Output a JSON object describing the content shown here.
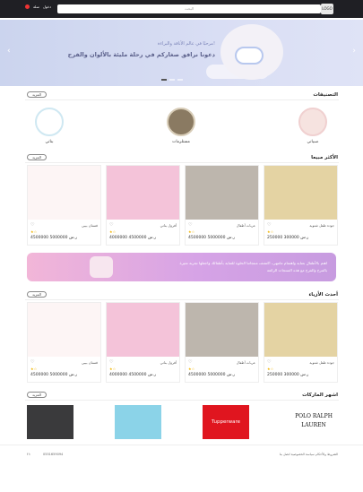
{
  "header": {
    "search_placeholder": "البحث",
    "cart_label": "سلة",
    "account_label": "دخول",
    "logo_text": "LOGO"
  },
  "hero": {
    "line1": "مرحبًا في عالم الأناقة والبراءة!",
    "line2": "دعونا نرافق صغاركم في رحلة مليئة بالألوان والفرح"
  },
  "categories": {
    "title": "التصنيفات",
    "more": "المزيد",
    "items": [
      {
        "label": "صبياني"
      },
      {
        "label": "مستلزمات"
      },
      {
        "label": "بناتي"
      }
    ]
  },
  "best_sellers": {
    "title": "الأكثر مبيعا",
    "more": "المزيد",
    "items": [
      {
        "name": "جودة طفل شتوية",
        "price": "250000 300000 ر.س"
      },
      {
        "name": "عربات أطفال",
        "price": "4500000 5000000 ر.س"
      },
      {
        "name": "أفرول بناتي",
        "price": "4000000 4500000 ر.س"
      },
      {
        "name": "فستان بيبي",
        "price": "4500000 5000000 ر.س"
      }
    ]
  },
  "promo": {
    "text": "اهتم بالأطفال بعناية واهتمام ماتتهى، اكتشف منتجاتنا الحلوة للعناية بأطفالك واجعلها تجربة مثيرة بالمرح والفرح مع هذه المنتجات الرائعة"
  },
  "latest": {
    "title": "أحدث الأزياء",
    "more": "المزيد",
    "items": [
      {
        "name": "جودة طفل شتوية",
        "price": "250000 300000 ر.س"
      },
      {
        "name": "عربات أطفال",
        "price": "4500000 5000000 ر.س"
      },
      {
        "name": "أفرول بناتي",
        "price": "4000000 4500000 ر.س"
      },
      {
        "name": "فستان بيبي",
        "price": "4500000 5000000 ر.س"
      }
    ]
  },
  "brands": {
    "title": "اشهر الماركات",
    "more": "المزيد",
    "items": [
      "POLO RALPH LAUREN",
      "Tupperware",
      "",
      ""
    ]
  },
  "footer": {
    "links": "الشروط والأحكام  سياسة الخصوصية  اتصل بنا",
    "phone": "0551659094",
    "social": "f  t"
  },
  "colors": {
    "accent": "#f0b400",
    "topbar": "#1f1f24"
  }
}
